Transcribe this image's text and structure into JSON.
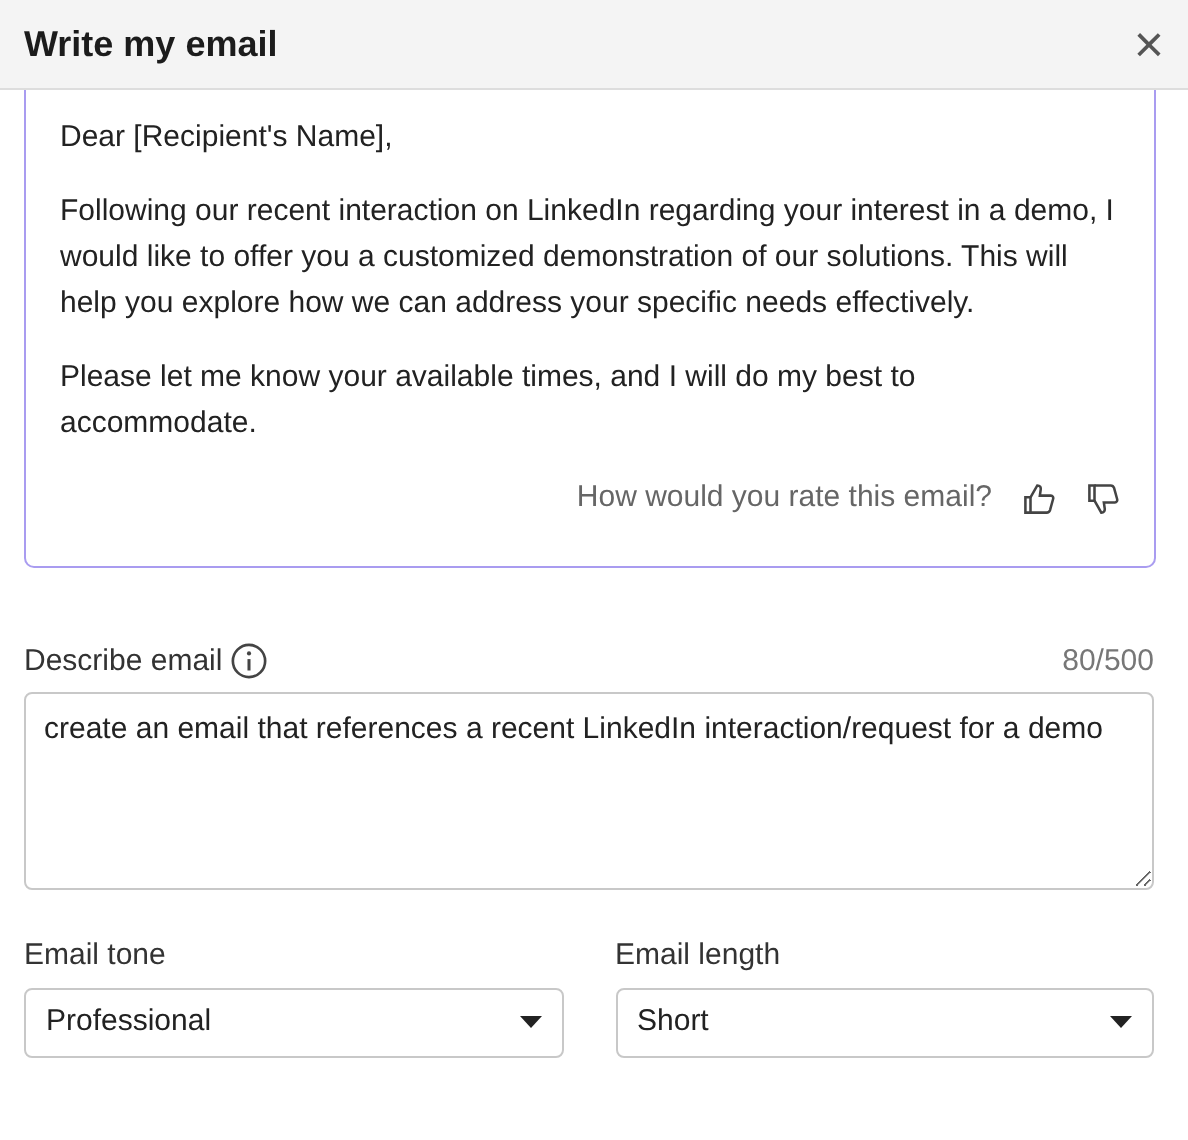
{
  "dialog": {
    "title": "Write my email",
    "close": "×"
  },
  "email": {
    "paragraphs": [
      "Dear [Recipient's Name],",
      "Following our recent interaction on LinkedIn regarding your interest in a demo, I would like to offer you a customized demonstration of our solutions. This will help you explore how we can address your specific needs effectively.",
      "Please let me know your available times, and I will do my best to accommodate."
    ],
    "rating_prompt": "How would you rate this email?"
  },
  "describe": {
    "label": "Describe email",
    "counter": "80/500",
    "value": "create an email that references a recent LinkedIn interaction/request for a demo"
  },
  "selects": [
    {
      "label": "Email tone",
      "value": "Professional"
    },
    {
      "label": "Email length",
      "value": "Short"
    }
  ]
}
